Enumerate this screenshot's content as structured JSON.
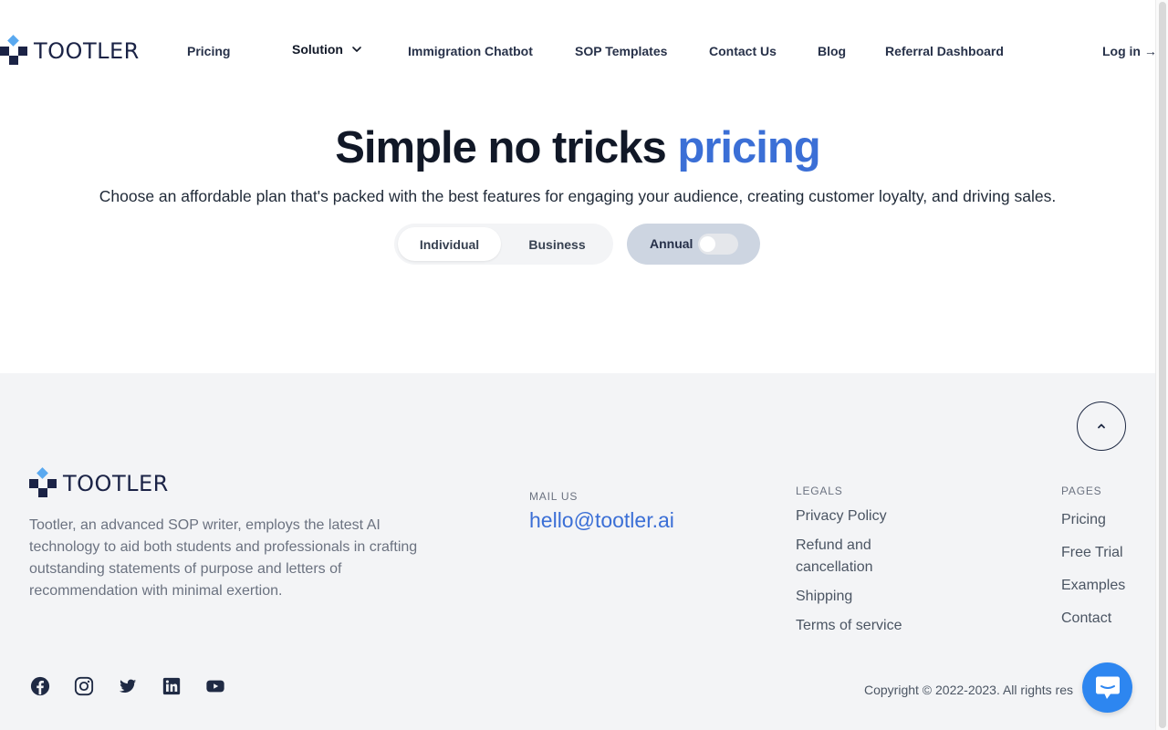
{
  "header": {
    "brand": "TOOTLER",
    "nav": {
      "pricing": "Pricing",
      "solution": "Solution",
      "chatbot": "Immigration Chatbot",
      "sop_templates": "SOP Templates",
      "contact": "Contact Us",
      "blog": "Blog",
      "referral": "Referral Dashboard",
      "login": "Log in →"
    }
  },
  "hero": {
    "title_main": "Simple no tricks",
    "title_accent": "pricing",
    "subtitle": "Choose an affordable plan that's packed with the best features for engaging your audience, creating customer loyalty, and driving sales.",
    "plan_options": [
      "Individual",
      "Business"
    ],
    "selected_plan": "Individual",
    "billing_label": "Annual",
    "annual_toggle_on": false
  },
  "footer": {
    "brand": "TOOTLER",
    "description": "Tootler, an advanced SOP writer, employs the latest AI technology to aid both students and professionals in crafting outstanding statements of purpose and letters of recommendation with minimal exertion.",
    "mail_label": "MAIL US",
    "mail": "hello@tootler.ai",
    "legals_label": "LEGALS",
    "legals": [
      "Privacy Policy",
      "Refund and cancellation",
      "Shipping",
      "Terms of service"
    ],
    "pages_label": "PAGES",
    "pages": [
      "Pricing",
      "Free Trial",
      "Examples",
      "Contact"
    ],
    "social_icons": [
      "facebook-icon",
      "instagram-icon",
      "twitter-icon",
      "linkedin-icon",
      "youtube-icon"
    ],
    "copyright": "Copyright © 2022-2023. All rights res"
  },
  "colors": {
    "accent": "#3b6fd6",
    "brand_navy": "#1b2346",
    "logo_light_blue": "#5aa9f0",
    "chat_button": "#2d86f0",
    "footer_bg": "#f3f4f6"
  }
}
